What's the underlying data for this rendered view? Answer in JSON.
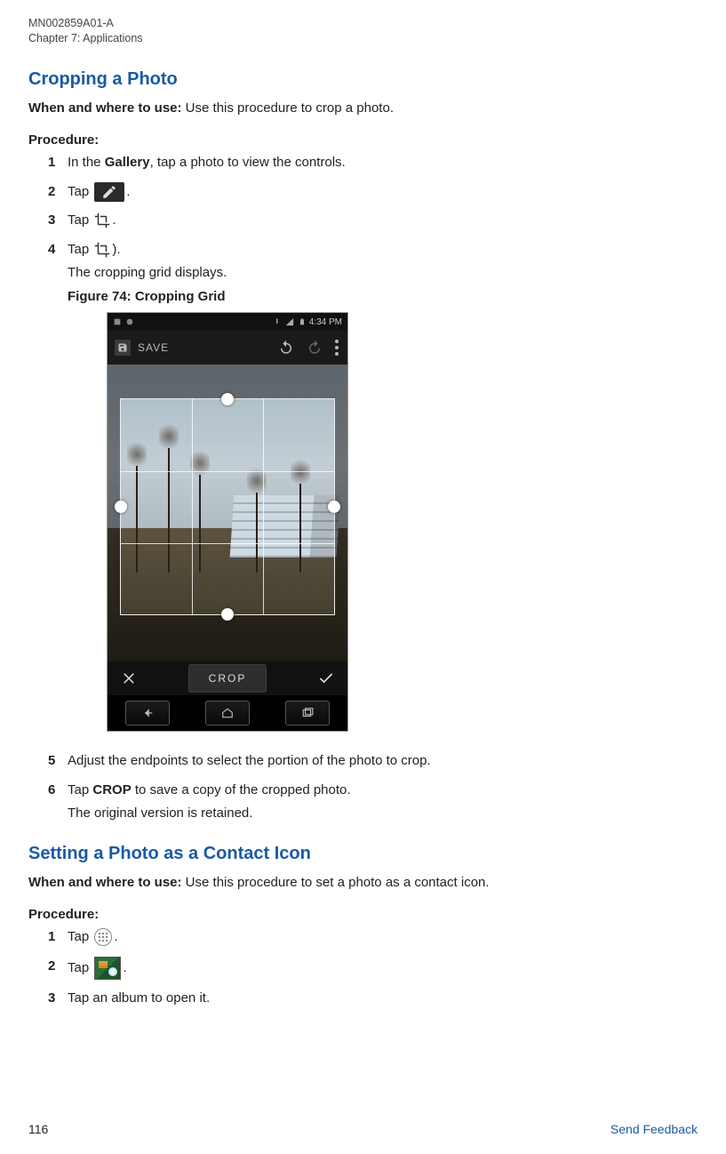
{
  "header": {
    "doc_id": "MN002859A01-A",
    "chapter": "Chapter 7:  Applications"
  },
  "section1": {
    "title": "Cropping a Photo",
    "when_label": "When and where to use:",
    "when_text": " Use this procedure to crop a photo.",
    "procedure_label": "Procedure:",
    "steps": {
      "s1_pre": "In the ",
      "s1_bold": "Gallery",
      "s1_post": ", tap a photo to view the controls.",
      "s2": "Tap ",
      "s2_post": ".",
      "s3": "Tap ",
      "s3_post": ".",
      "s4": "Tap ",
      "s4_post": ").",
      "s4_sub1": "The cropping grid displays.",
      "s4_fig": "Figure 74: Cropping Grid",
      "s5": "Adjust the endpoints to select the portion of the photo to crop.",
      "s6_pre": "Tap ",
      "s6_bold": "CROP",
      "s6_post": " to save a copy of the cropped photo.",
      "s6_sub": "The original version is retained."
    }
  },
  "figure": {
    "status_time": "4:34 PM",
    "save_label": "SAVE",
    "crop_btn": "CROP"
  },
  "section2": {
    "title": "Setting a Photo as a Contact Icon",
    "when_label": "When and where to use:",
    "when_text": " Use this procedure to set a photo as a contact icon.",
    "procedure_label": "Procedure:",
    "steps": {
      "s1": "Tap ",
      "s1_post": ".",
      "s2": "Tap ",
      "s2_post": ".",
      "s3": "Tap an album to open it."
    }
  },
  "footer": {
    "page": "116",
    "link": "Send Feedback"
  }
}
